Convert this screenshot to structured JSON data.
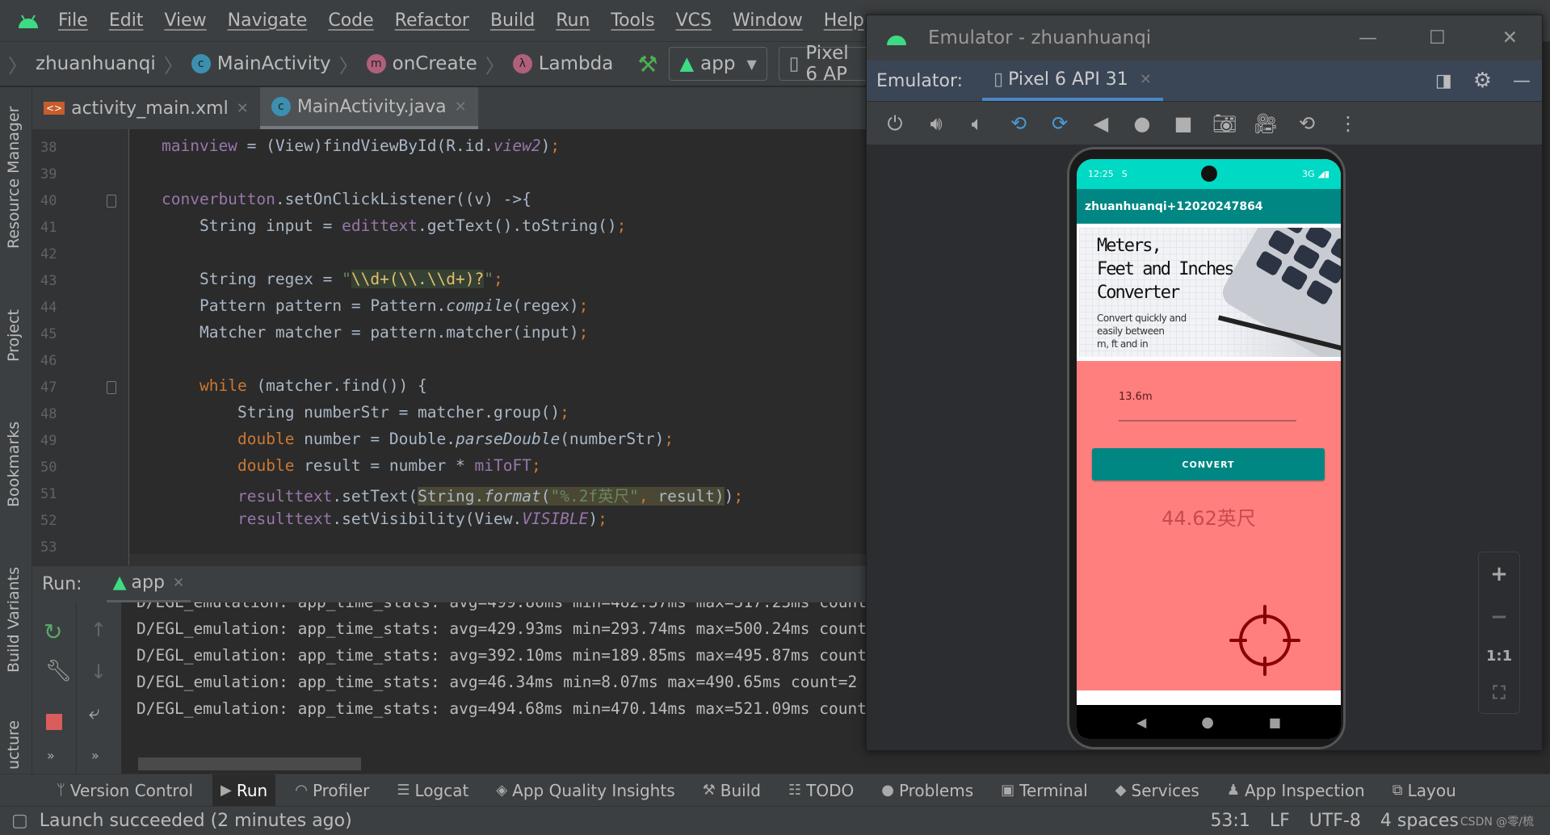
{
  "menu": [
    "File",
    "Edit",
    "View",
    "Navigate",
    "Code",
    "Refactor",
    "Build",
    "Run",
    "Tools",
    "VCS",
    "Window",
    "Help"
  ],
  "breadcrumb": [
    {
      "label": "zhuanhuanqi",
      "badge": ""
    },
    {
      "label": "MainActivity",
      "badge": "c"
    },
    {
      "label": "onCreate",
      "badge": "m"
    },
    {
      "label": "Lambda",
      "badge": "λ"
    }
  ],
  "toolbar": {
    "config": "app",
    "device": "Pixel 6 AP"
  },
  "left_tools": [
    "Resource Manager",
    "Project",
    "Bookmarks",
    "Build Variants",
    "ucture"
  ],
  "tabs": [
    {
      "label": "activity_main.xml"
    },
    {
      "label": "MainActivity.java"
    }
  ],
  "editor": {
    "line_numbers": [
      "38",
      "39",
      "40",
      "41",
      "42",
      "43",
      "44",
      "45",
      "46",
      "47",
      "48",
      "49",
      "50",
      "51",
      "52",
      "53"
    ],
    "lines": [
      {
        "indent": 2,
        "tokens": [
          [
            "mainview",
            "field"
          ],
          [
            " = (View)findViewById(R.id.",
            ""
          ],
          [
            "view2",
            "fit"
          ],
          [
            ")",
            ""
          ],
          [
            ";",
            "kw"
          ]
        ]
      },
      {
        "indent": 0,
        "tokens": []
      },
      {
        "indent": 2,
        "tokens": [
          [
            "converbutton",
            "field"
          ],
          [
            ".setOnClickListener((v) ->{",
            ""
          ]
        ]
      },
      {
        "indent": 3,
        "tokens": [
          [
            "String input = ",
            ""
          ],
          [
            "edittext",
            "field"
          ],
          [
            ".getText().toString()",
            ""
          ],
          [
            ";",
            "kw"
          ]
        ]
      },
      {
        "indent": 0,
        "tokens": []
      },
      {
        "indent": 3,
        "tokens": [
          [
            "String regex = ",
            ""
          ],
          [
            "\"",
            "str"
          ],
          [
            "\\\\d+(\\\\.\\\\d+)?",
            "rx"
          ],
          [
            "\"",
            "str"
          ],
          [
            ";",
            "kw"
          ]
        ]
      },
      {
        "indent": 3,
        "tokens": [
          [
            "Pattern pattern = Pattern.",
            ""
          ],
          [
            "compile",
            "it"
          ],
          [
            "(regex)",
            ""
          ],
          [
            ";",
            "kw"
          ]
        ]
      },
      {
        "indent": 3,
        "tokens": [
          [
            "Matcher matcher = pattern.matcher(input)",
            ""
          ],
          [
            ";",
            "kw"
          ]
        ]
      },
      {
        "indent": 0,
        "tokens": []
      },
      {
        "indent": 3,
        "tokens": [
          [
            "while",
            "kw"
          ],
          [
            " (matcher.find()) {",
            ""
          ]
        ]
      },
      {
        "indent": 4,
        "tokens": [
          [
            "String numberStr = matcher.group()",
            ""
          ],
          [
            ";",
            "kw"
          ]
        ]
      },
      {
        "indent": 4,
        "tokens": [
          [
            "double",
            "kw"
          ],
          [
            " number = Double.",
            ""
          ],
          [
            "parseDouble",
            "it"
          ],
          [
            "(numberStr)",
            ""
          ],
          [
            ";",
            "kw"
          ]
        ]
      },
      {
        "indent": 4,
        "tokens": [
          [
            "double",
            "kw"
          ],
          [
            " result = number * ",
            ""
          ],
          [
            "miToFT",
            "field"
          ],
          [
            ";",
            "kw"
          ]
        ]
      },
      {
        "indent": 4,
        "tokens": [
          [
            "resulttext",
            "field"
          ],
          [
            ".setText(",
            ""
          ],
          [
            "String.",
            "hl"
          ],
          [
            "format",
            "hl it"
          ],
          [
            "(",
            "hl"
          ],
          [
            "\"%.2f英尺\"",
            "hl str"
          ],
          [
            ", ",
            "hl kw"
          ],
          [
            "result)",
            "hl"
          ],
          [
            ")",
            ""
          ],
          [
            ";",
            "kw"
          ]
        ]
      },
      {
        "indent": 4,
        "tokens": [
          [
            "resulttext",
            "field"
          ],
          [
            ".setVisibility(View.",
            ""
          ],
          [
            "VISIBLE",
            "fit"
          ],
          [
            ")",
            ""
          ],
          [
            ";",
            "kw"
          ]
        ]
      },
      {
        "indent": 0,
        "tokens": []
      }
    ]
  },
  "run": {
    "label": "Run:",
    "tab": "app",
    "logs": [
      "D/EGL_emulation: app_time_stats: avg=499.86ms min=482.57ms max=517.23ms count",
      "D/EGL_emulation: app_time_stats: avg=429.93ms min=293.74ms max=500.24ms count",
      "D/EGL_emulation: app_time_stats: avg=392.10ms min=189.85ms max=495.87ms count",
      "D/EGL_emulation: app_time_stats: avg=46.34ms min=8.07ms max=490.65ms count=2",
      "D/EGL_emulation: app_time_stats: avg=494.68ms min=470.14ms max=521.09ms count"
    ]
  },
  "bottom_tabs": [
    {
      "label": "Version Control",
      "icon": "ᛘ"
    },
    {
      "label": "Run",
      "icon": "▶"
    },
    {
      "label": "Profiler",
      "icon": "◠"
    },
    {
      "label": "Logcat",
      "icon": "☰"
    },
    {
      "label": "App Quality Insights",
      "icon": "◈"
    },
    {
      "label": "Build",
      "icon": "⚒"
    },
    {
      "label": "TODO",
      "icon": "☷"
    },
    {
      "label": "Problems",
      "icon": "●"
    },
    {
      "label": "Terminal",
      "icon": "▣"
    },
    {
      "label": "Services",
      "icon": "◆"
    },
    {
      "label": "App Inspection",
      "icon": "♟"
    },
    {
      "label": "Layou",
      "icon": "⧉"
    }
  ],
  "status": {
    "message": "Launch succeeded (2 minutes ago)",
    "position": "53:1",
    "line_ending": "LF",
    "encoding": "UTF-8",
    "indent": "4 spaces",
    "watermark": "CSDN @零/梳"
  },
  "emulator": {
    "title": "Emulator - zhuanhuanqi",
    "label": "Emulator:",
    "device_tab": "Pixel 6 API 31",
    "tools": [
      "power-icon",
      "volume-up-icon",
      "volume-down-icon",
      "rotate-left-icon",
      "rotate-right-icon",
      "back-icon",
      "home-icon",
      "overview-icon",
      "screenshot-icon",
      "record-icon",
      "snapshot-icon",
      "more-icon"
    ],
    "zoom": {
      "in": "+",
      "out": "−",
      "actual": "1:1"
    }
  },
  "phone": {
    "time": "12:25",
    "network": "3G",
    "app_title": "zhuanhuanqi+12020247864",
    "banner": {
      "title_lines": [
        "Meters,",
        "Feet and Inches",
        "Converter"
      ],
      "sub_lines": [
        "Convert quickly and",
        "easily between",
        "m, ft and in"
      ]
    },
    "input_value": "13.6m",
    "button": "CONVERT",
    "result": "44.62英尺",
    "colors": {
      "status": "#00d9c4",
      "appbar": "#008784",
      "content": "#ff7f7f",
      "button": "#008784",
      "result": "#c94a4a",
      "crosshair": "#8b0000"
    }
  }
}
